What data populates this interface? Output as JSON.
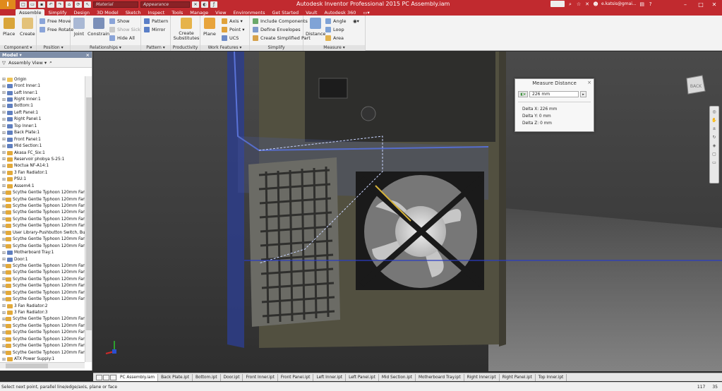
{
  "app": {
    "title": "Autodesk Inventor Professional 2015   PC Assembly.iam",
    "logo_letter": "I",
    "quick_access": {
      "material_placeholder": "Material",
      "appearance_placeholder": "Appearance"
    },
    "user": "e.katsis@gmai...",
    "window_controls": [
      "–",
      "□",
      "✕"
    ]
  },
  "tabs": [
    "Assemble",
    "Simplify",
    "Design",
    "3D Model",
    "Sketch",
    "Inspect",
    "Tools",
    "Manage",
    "View",
    "Environments",
    "Get Started",
    "Vault",
    "Autodesk 360"
  ],
  "active_tab": "Assemble",
  "ribbon": {
    "component": {
      "title": "Component ▾",
      "place": "Place",
      "create": "Create"
    },
    "position": {
      "title": "Position ▾",
      "free_move": "Free Move",
      "free_rotate": "Free Rotate"
    },
    "relationships": {
      "title": "Relationships ▾",
      "joint": "Joint",
      "constrain": "Constrain",
      "show": "Show",
      "show_sick": "Show Sick",
      "hide_all": "Hide All"
    },
    "pattern": {
      "title": "Pattern ▾",
      "pattern": "Pattern",
      "mirror": "Mirror"
    },
    "productivity": {
      "title": "Productivity",
      "create_substitutes": "Create Substitutes"
    },
    "work_features": {
      "title": "Work Features ▾",
      "plane": "Plane",
      "axis": "Axis ▾",
      "point": "Point ▾",
      "ucs": "UCS"
    },
    "simplify": {
      "title": "Simplify",
      "include_components": "Include Components",
      "define_envelopes": "Define Envelopes",
      "create_simplified_part": "Create Simplified Part"
    },
    "measure": {
      "title": "Measure ▾",
      "distance": "Distance",
      "angle": "Angle",
      "loop": "Loop",
      "area": "Area"
    }
  },
  "browser": {
    "title": "Model ▾",
    "view_label": "Assembly View ▾",
    "items": [
      "Origin",
      "Front Inner:1",
      "Left Inner:1",
      "Right Inner:1",
      "Bottom:1",
      "Left Panel:1",
      "Right Panel:1",
      "Top Inner:1",
      "Back Plate:1",
      "Front Panel:1",
      "Mid Section:1",
      "Akasa FC_Six:1",
      "Reservoir phobya S-25:1",
      "Noctua NF-A14:1",
      "3 Fan Radiator:1",
      "PSU:1",
      "Assem4:1",
      "Scythe Gentle Typhoon 120mm Fan:1",
      "Scythe Gentle Typhoon 120mm Fan:2",
      "Scythe Gentle Typhoon 120mm Fan:3",
      "Scythe Gentle Typhoon 120mm Fan:4",
      "Scythe Gentle Typhoon 120mm Fan:5",
      "Scythe Gentle Typhoon 120mm Fan:6",
      "User Library-Pushbutton Switch, Bulg",
      "Scythe Gentle Typhoon 120mm Fan:7",
      "Scythe Gentle Typhoon 120mm Fan:8",
      "Motherboard Tray:1",
      "Door:1",
      "Scythe Gentle Typhoon 120mm Fan:9",
      "Scythe Gentle Typhoon 120mm Fan:1",
      "Scythe Gentle Typhoon 120mm Fan:1",
      "Scythe Gentle Typhoon 120mm Fan:1",
      "Scythe Gentle Typhoon 120mm Fan:1",
      "Scythe Gentle Typhoon 120mm Fan:1",
      "3 Fan Radiator:2",
      "3 Fan Radiator:3",
      "Scythe Gentle Typhoon 120mm Fan:1",
      "Scythe Gentle Typhoon 120mm Fan:1",
      "Scythe Gentle Typhoon 120mm Fan:1",
      "Scythe Gentle Typhoon 120mm Fan:1",
      "Scythe Gentle Typhoon 120mm Fan:1",
      "Scythe Gentle Typhoon 120mm Fan:2",
      "ATX Power Supply:1"
    ]
  },
  "measure_dialog": {
    "title": "Measure Distance",
    "value": "226 mm",
    "delta_x": "Delta X: 226 mm",
    "delta_y": "Delta Y: 0 mm",
    "delta_z": "Delta Z: 0 mm"
  },
  "viewcube_label": "BACK",
  "doc_tabs": [
    "PC Assembly.iam",
    "Back Plate.ipt",
    "Bottom.ipt",
    "Door.ipt",
    "Front Inner.ipt",
    "Front Panel.ipt",
    "Left Inner.ipt",
    "Left Panel.ipt",
    "Mid Section.ipt",
    "Motherboard Tray.ipt",
    "Right Inner.ipt",
    "Right Panel.ipt",
    "Top Inner.ipt"
  ],
  "status": {
    "message": "Select next point, parallel line/edge/axis, plane or face",
    "num1": "117",
    "num2": "35"
  },
  "colors": {
    "title_red": "#c12a2f",
    "accent_blue": "#3a55c8"
  }
}
